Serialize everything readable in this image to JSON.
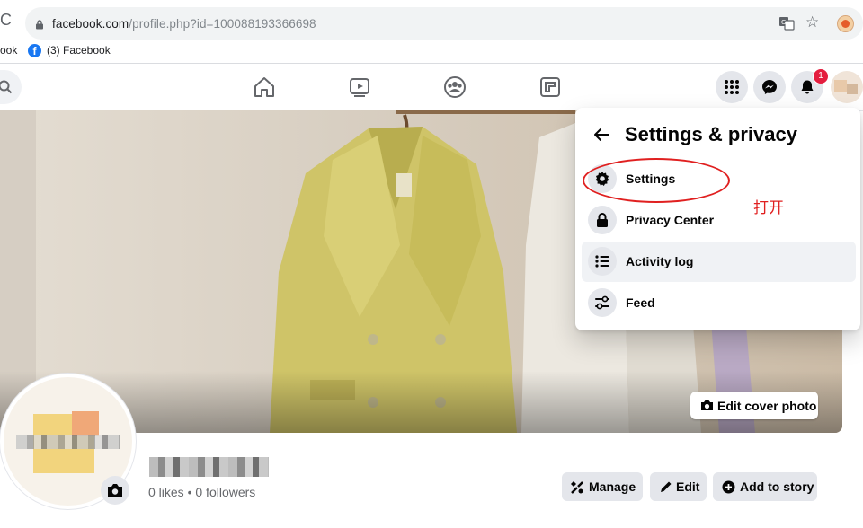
{
  "browser": {
    "url_domain": "facebook.com",
    "url_rest": "/profile.php?id=100088193366698",
    "bookmark_partial": "ook",
    "bookmark_label": "(3) Facebook"
  },
  "notifications": {
    "badge_count": "1"
  },
  "menu": {
    "title": "Settings & privacy",
    "items": [
      {
        "label": "Settings",
        "icon": "gear-icon"
      },
      {
        "label": "Privacy Center",
        "icon": "lock-icon"
      },
      {
        "label": "Activity log",
        "icon": "list-icon"
      },
      {
        "label": "Feed",
        "icon": "sliders-icon"
      }
    ]
  },
  "annotation": {
    "text": "打开",
    "color": "#e02020"
  },
  "cover": {
    "edit_label": "Edit cover photo"
  },
  "profile": {
    "likes": "0 likes",
    "separator": "•",
    "followers": "0 followers"
  },
  "actions": {
    "manage": "Manage",
    "edit": "Edit",
    "add_story": "Add to story"
  },
  "colors": {
    "accent": "#1877f2",
    "badge": "#e41e3f",
    "button_bg": "#e4e6eb"
  }
}
